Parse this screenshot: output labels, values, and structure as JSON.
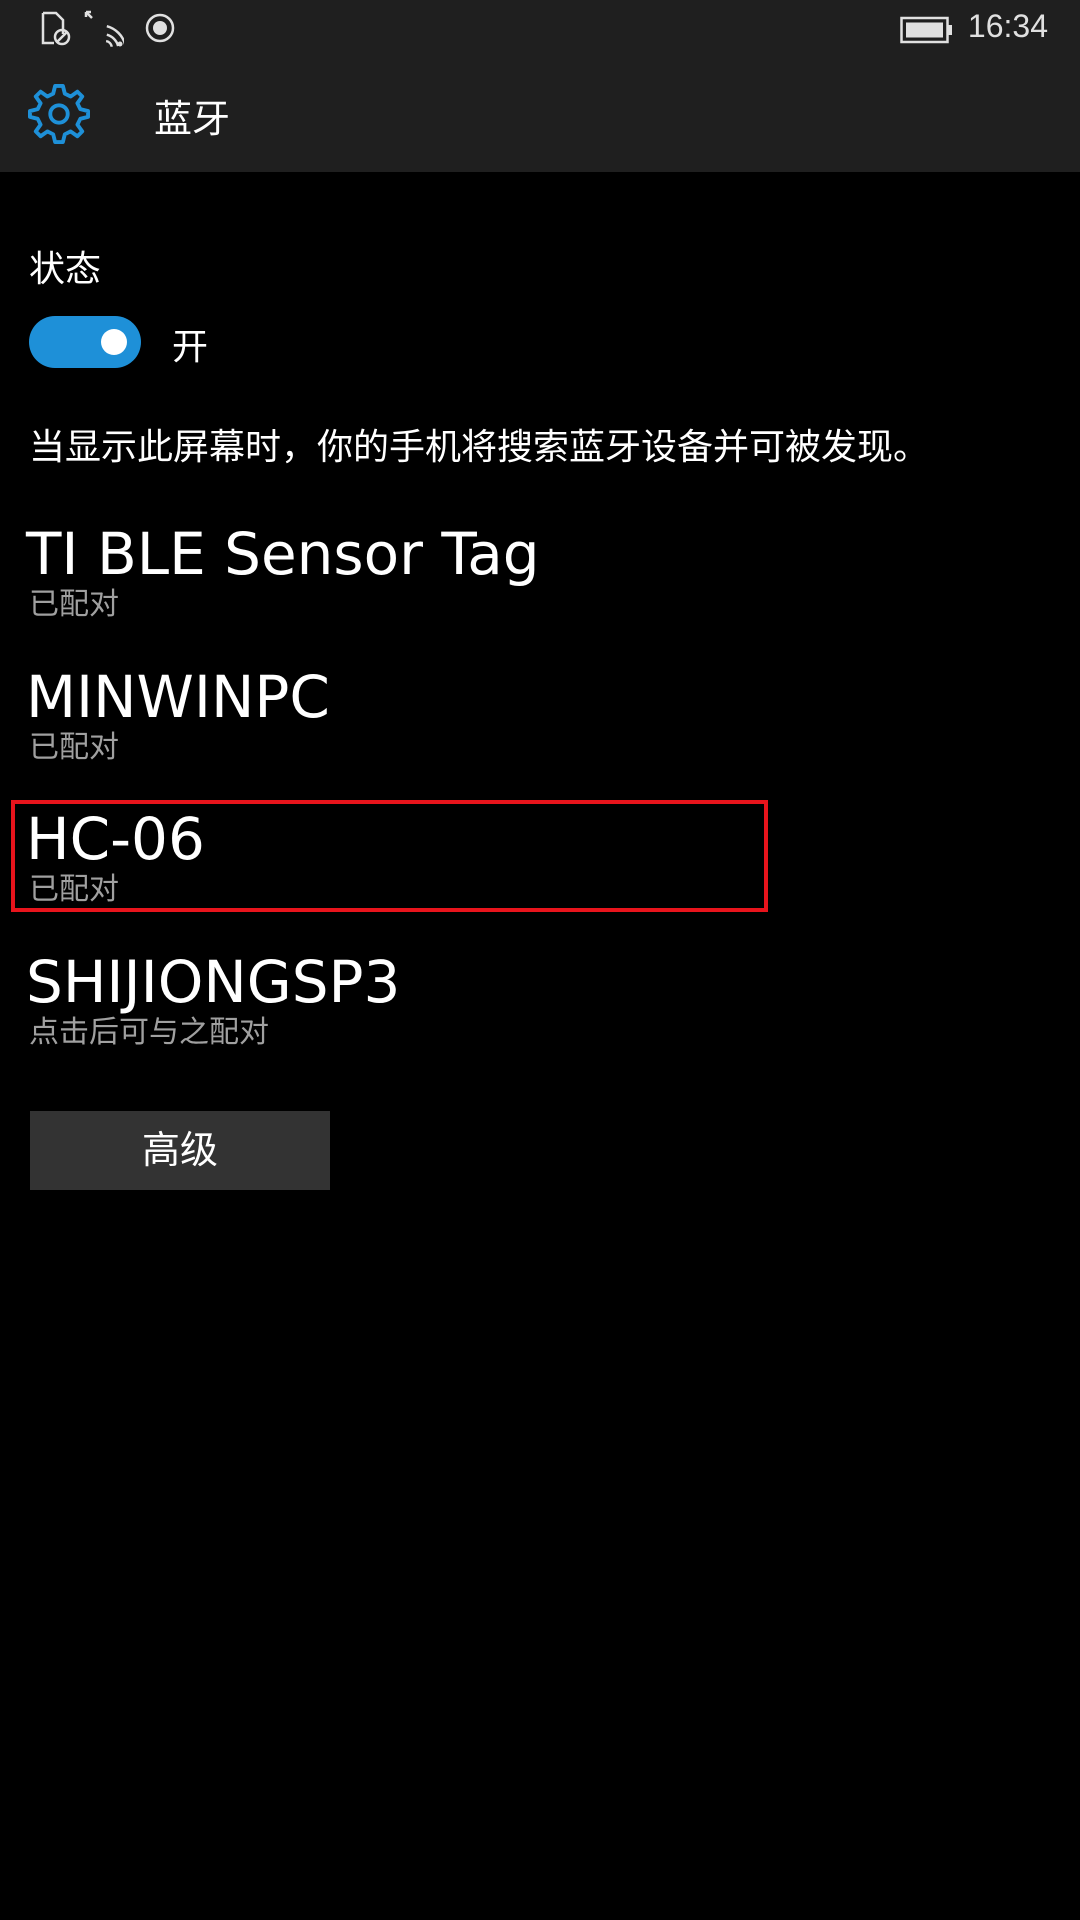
{
  "status_bar": {
    "time": "16:34",
    "icons": [
      "no-sim-icon",
      "wifi-icon",
      "location-icon",
      "battery-icon"
    ]
  },
  "header": {
    "title": "蓝牙",
    "icon": "gear-icon",
    "accent_color": "#1e90d8"
  },
  "state": {
    "label": "状态",
    "toggle_on": true,
    "toggle_label": "开"
  },
  "description": "当显示此屏幕时，你的手机将搜索蓝牙设备并可被发现。",
  "devices": [
    {
      "name": "TI BLE Sensor Tag",
      "status": "已配对"
    },
    {
      "name": "MINWINPC",
      "status": "已配对"
    },
    {
      "name": "HC-06",
      "status": "已配对",
      "highlighted": true
    },
    {
      "name": "SHIJIONGSP3",
      "status": "点击后可与之配对"
    }
  ],
  "highlight_color": "#e8141c",
  "advanced_button": {
    "label": "高级"
  }
}
